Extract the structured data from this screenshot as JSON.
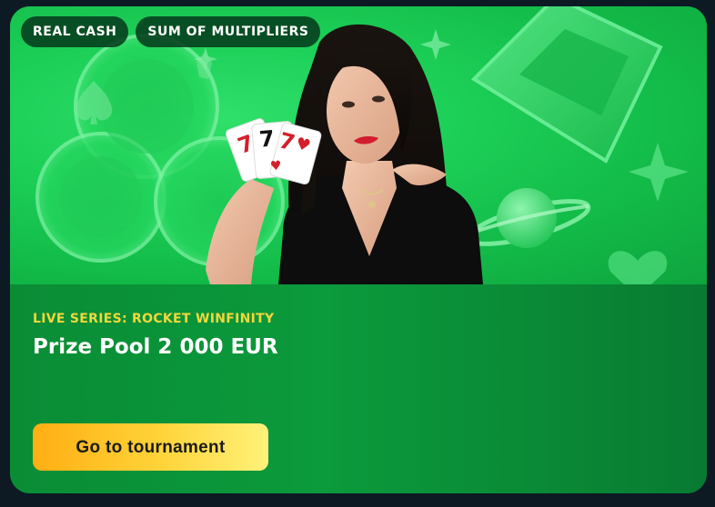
{
  "badges": {
    "real_cash": "REAL CASH",
    "sum_multipliers": "SUM OF MULTIPLIERS"
  },
  "promo": {
    "series_label": "LIVE SERIES: ROCKET WINFINITY",
    "prize_text": "Prize Pool 2 000 EUR",
    "cta_label": "Go to tournament"
  },
  "cards": {
    "card1": "7",
    "card2": "7",
    "card3": "7"
  },
  "colors": {
    "accent_yellow": "#f2d83a",
    "button_start": "#ffae12",
    "button_end": "#fff27a",
    "hero_green": "#1ccf57"
  }
}
